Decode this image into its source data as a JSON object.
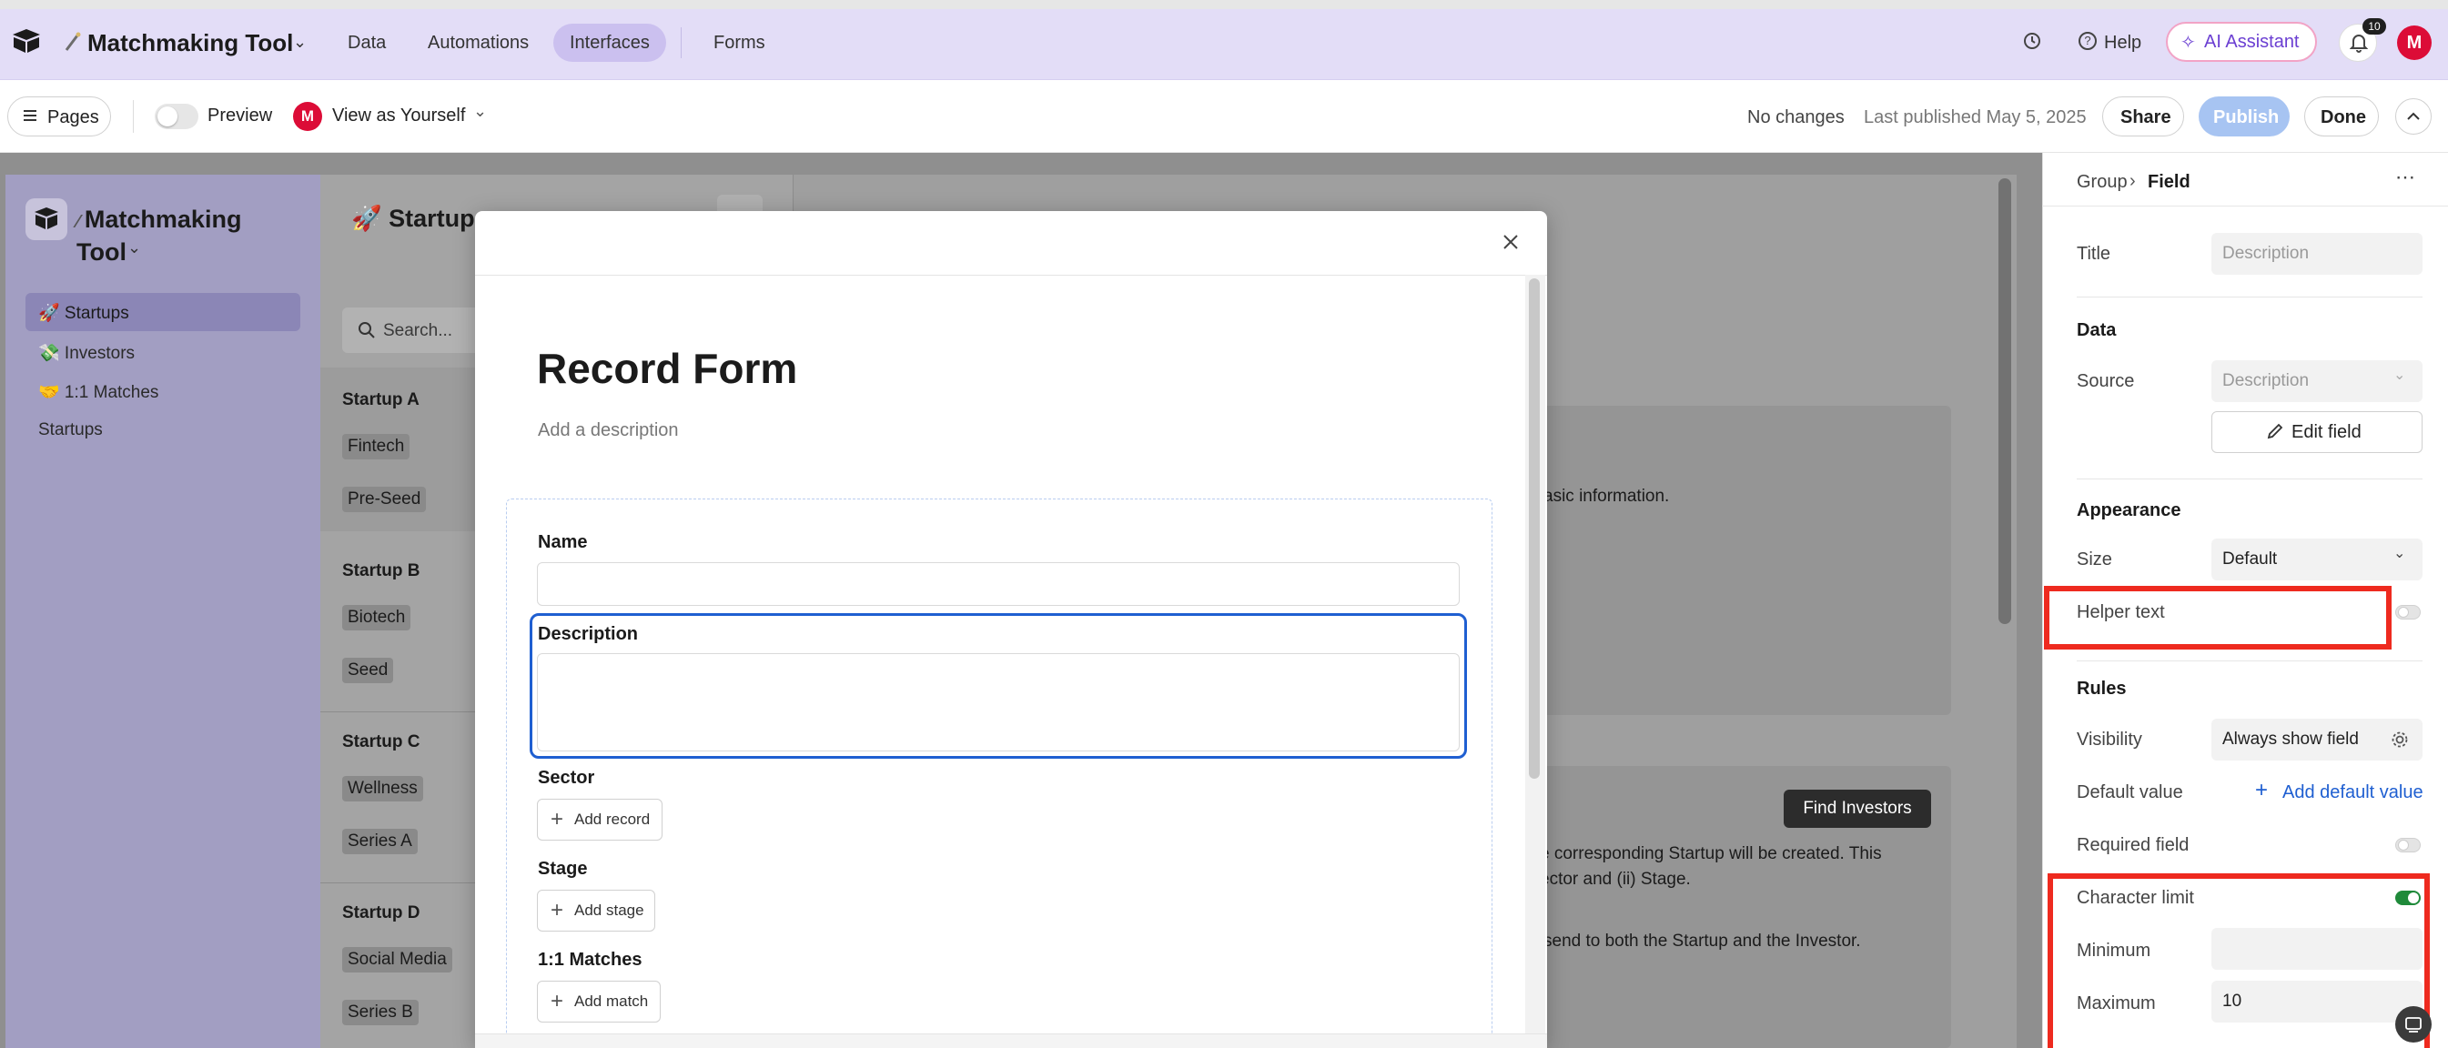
{
  "topnav": {
    "base_name": "Matchmaking Tool",
    "tabs": [
      "Data",
      "Automations",
      "Interfaces",
      "Forms"
    ],
    "help_label": "Help",
    "ai_label": "AI Assistant",
    "notif_count": "10",
    "avatar_letter": "M"
  },
  "toolbar": {
    "pages_label": "Pages",
    "preview_label": "Preview",
    "view_as_label": "View as Yourself",
    "avatar_letter": "M",
    "status": "No changes",
    "last_published": "Last published May 5, 2025",
    "share_label": "Share",
    "publish_label": "Publish",
    "done_label": "Done"
  },
  "interface": {
    "app_title_line1": "Matchmaking",
    "app_title_line2": "Tool",
    "nav_items": [
      "🚀 Startups",
      "💸 Investors",
      "🤝 1:1 Matches",
      "Startups"
    ],
    "page_title": "🚀 Startups",
    "search_placeholder": "Search...",
    "records": [
      {
        "name": "Startup A",
        "sector": "Fintech",
        "stage": "Pre-Seed"
      },
      {
        "name": "Startup B",
        "sector": "Biotech",
        "stage": "Seed"
      },
      {
        "name": "Startup C",
        "sector": "Wellness",
        "stage": "Series A"
      },
      {
        "name": "Startup D",
        "sector": "Social Media",
        "stage": "Series B"
      }
    ],
    "bg_text_1": "asic information.",
    "find_investors_label": "Find Investors",
    "bg_text_2a": "e corresponding Startup will be created. This",
    "bg_text_2b": "ector and (ii) Stage.",
    "bg_text_3": "send to both the Startup and the Investor."
  },
  "modal": {
    "title": "Record Form",
    "description_placeholder": "Add a description",
    "fields": {
      "name_label": "Name",
      "description_label": "Description",
      "sector_label": "Sector",
      "sector_button": "Add record",
      "stage_label": "Stage",
      "stage_button": "Add stage",
      "matches_label": "1:1 Matches",
      "matches_button": "Add match"
    }
  },
  "rpanel": {
    "breadcrumb_parent": "Group",
    "breadcrumb_current": "Field",
    "title_label": "Title",
    "title_value": "Description",
    "data_heading": "Data",
    "source_label": "Source",
    "source_value": "Description",
    "edit_field_label": "Edit field",
    "appearance_heading": "Appearance",
    "size_label": "Size",
    "size_value": "Default",
    "helper_text_label": "Helper text",
    "rules_heading": "Rules",
    "visibility_label": "Visibility",
    "visibility_value": "Always show field",
    "default_value_label": "Default value",
    "add_default_label": "Add default value",
    "required_label": "Required field",
    "char_limit_label": "Character limit",
    "minimum_label": "Minimum",
    "minimum_value": "",
    "maximum_label": "Maximum",
    "maximum_value": "10"
  },
  "colors": {
    "nav_bg": "#e3ddf7",
    "accent_blue": "#1f5fd1",
    "publish_bg": "#a7c4f2",
    "avatar_red": "#dc0c37",
    "highlight_red": "#ee2a1f",
    "toggle_on": "#1f8a3a"
  }
}
